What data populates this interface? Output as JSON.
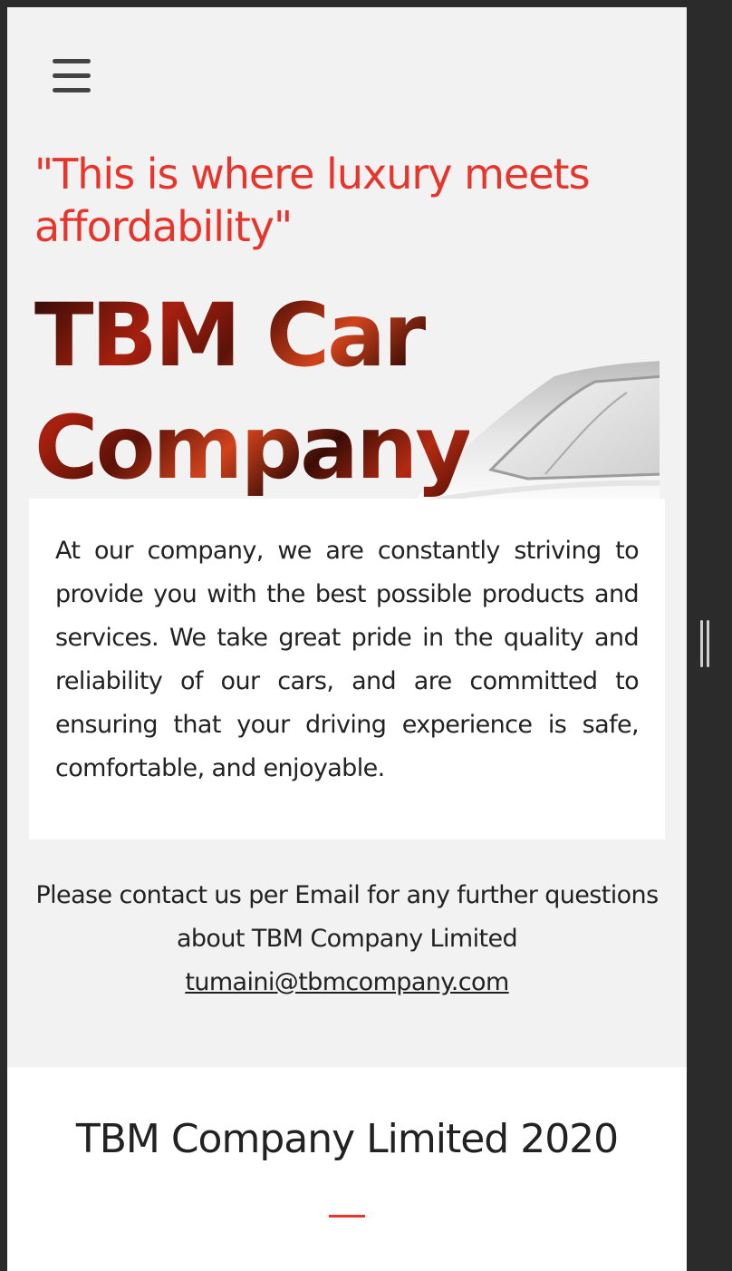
{
  "header": {
    "menu_icon": "hamburger-menu-icon"
  },
  "hero": {
    "tagline": "\"This is where luxury meets affordability\"",
    "title_line1": "TBM Car",
    "title_line2": "Company",
    "image": "car-icon"
  },
  "about": {
    "text": "At our company, we are constantly striving to provide you with the best possible products and services. We take great pride in the quality and reliability of our cars, and are committed to ensuring that your driving experience is safe, comfortable, and enjoyable."
  },
  "contact": {
    "line": "Please contact us per Email for any further questions about TBM Company Limited",
    "email": "tumaini@tbmcompany.com"
  },
  "footer": {
    "title": "TBM Company Limited 2020"
  },
  "colors": {
    "accent": "#e8352b",
    "text": "#222222",
    "page_bg": "#f2f2f2",
    "card_bg": "#ffffff",
    "frame_bg": "#2b2b2b"
  }
}
